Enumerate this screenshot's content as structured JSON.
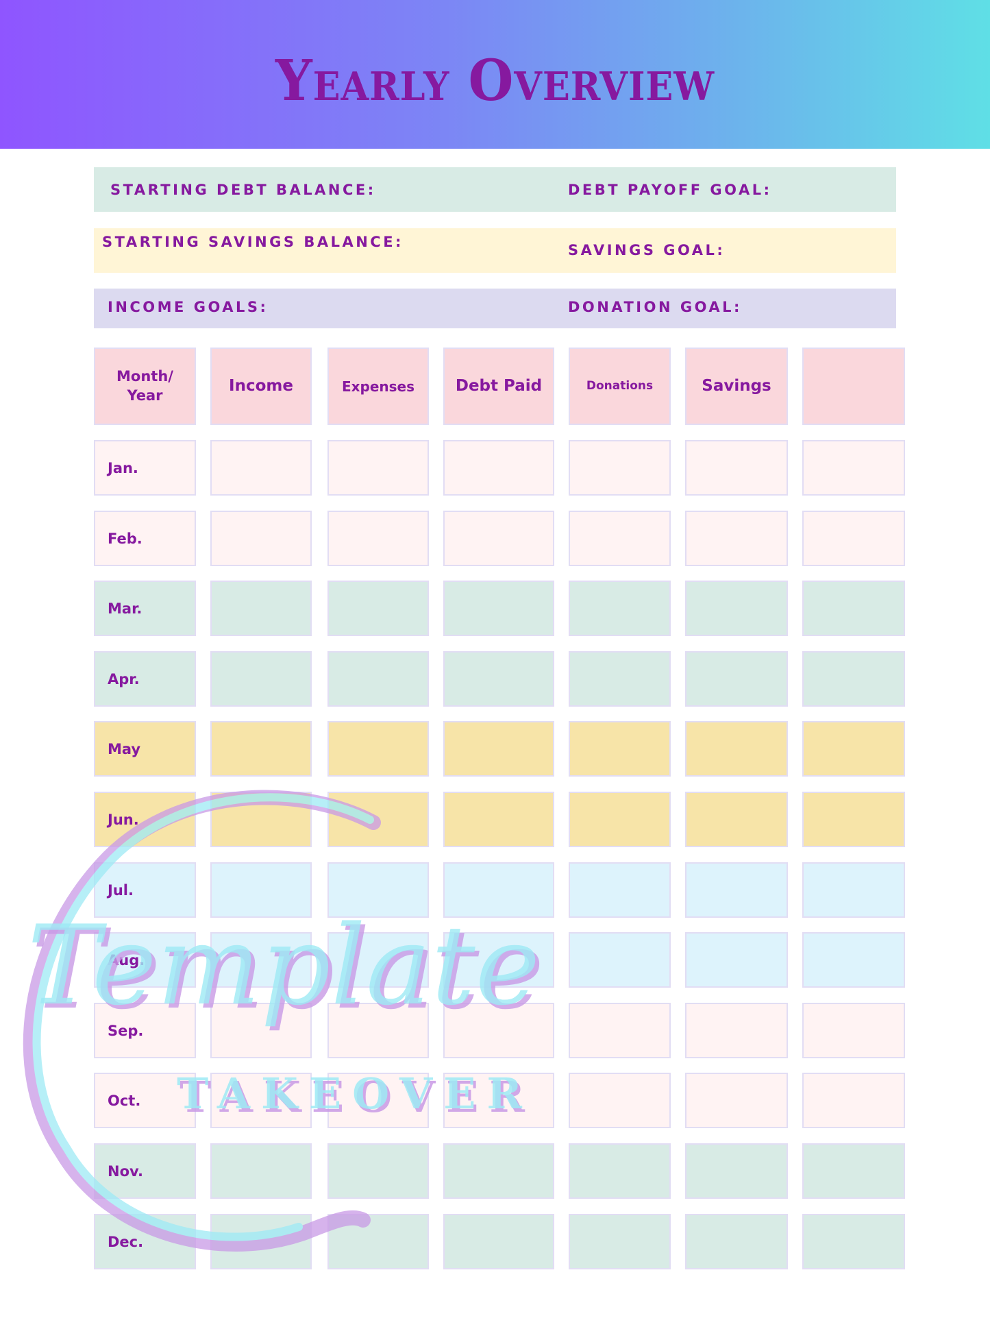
{
  "title": "Yearly Overview",
  "colors": {
    "accent_text": "#86199F",
    "banner_gradient_start": "#8F55FF",
    "banner_gradient_end": "#5FDFE6",
    "header_cell": "#FAD7DC",
    "pink_row": "#FFF3F3",
    "green_row": "#D8EBE5",
    "yellow_row": "#F7E4A8",
    "blue_row": "#DDF3FC"
  },
  "goals": [
    {
      "left": "STARTING DEBT BALANCE:",
      "right": "DEBT PAYOFF GOAL:"
    },
    {
      "left": "STARTING SAVINGS BALANCE:",
      "right": "SAVINGS GOAL:"
    },
    {
      "left": "INCOME GOALS:",
      "right": "DONATION GOAL:"
    }
  ],
  "table": {
    "headers": [
      "Month/ Year",
      "Income",
      "Expenses",
      "Debt Paid",
      "Donations",
      "Savings",
      ""
    ],
    "rows": [
      {
        "month": "Jan.",
        "tone": "pink"
      },
      {
        "month": "Feb.",
        "tone": "pink"
      },
      {
        "month": "Mar.",
        "tone": "green"
      },
      {
        "month": "Apr.",
        "tone": "green"
      },
      {
        "month": "May",
        "tone": "yellow"
      },
      {
        "month": "Jun.",
        "tone": "yellow"
      },
      {
        "month": "Jul.",
        "tone": "blue"
      },
      {
        "month": "Aug.",
        "tone": "blue"
      },
      {
        "month": "Sep.",
        "tone": "pink"
      },
      {
        "month": "Oct.",
        "tone": "pink"
      },
      {
        "month": "Nov.",
        "tone": "green"
      },
      {
        "month": "Dec.",
        "tone": "green"
      }
    ]
  },
  "watermark": {
    "line1": "Template",
    "line2": "TAKEOVER"
  }
}
